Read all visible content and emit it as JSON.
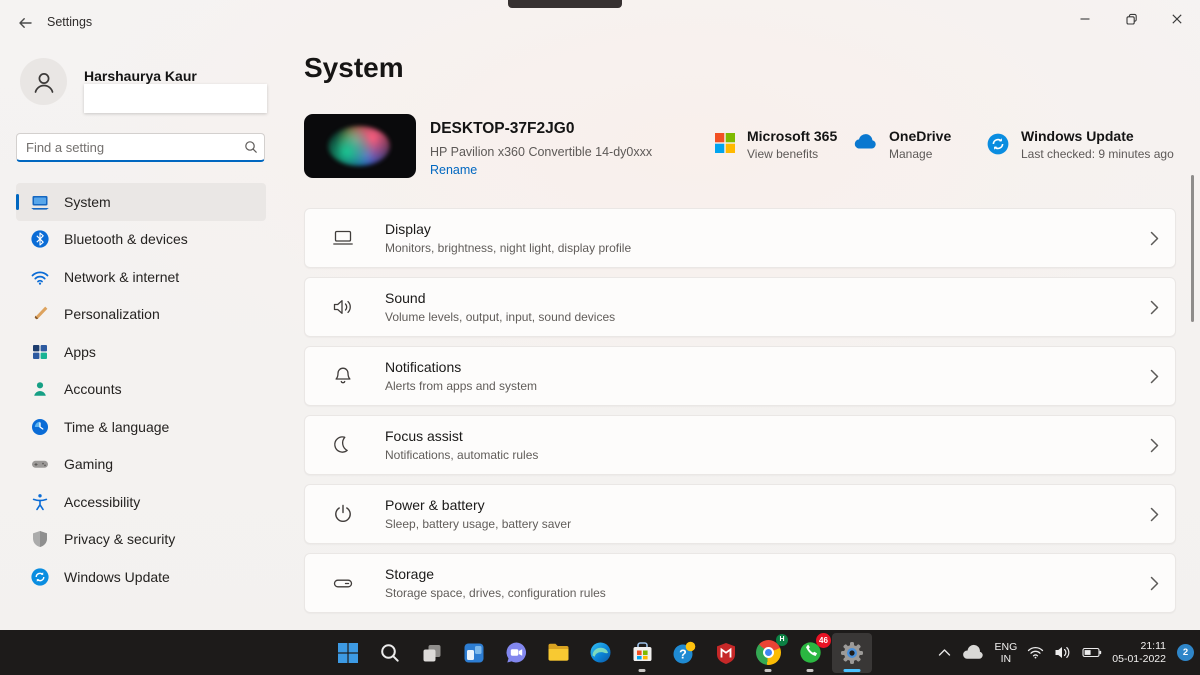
{
  "window": {
    "title": "Settings"
  },
  "sidebar": {
    "user": {
      "name": "Harshaurya Kaur"
    },
    "search": {
      "placeholder": "Find a setting"
    },
    "items": [
      {
        "label": "System",
        "active": true
      },
      {
        "label": "Bluetooth & devices"
      },
      {
        "label": "Network & internet"
      },
      {
        "label": "Personalization"
      },
      {
        "label": "Apps"
      },
      {
        "label": "Accounts"
      },
      {
        "label": "Time & language"
      },
      {
        "label": "Gaming"
      },
      {
        "label": "Accessibility"
      },
      {
        "label": "Privacy & security"
      },
      {
        "label": "Windows Update"
      }
    ]
  },
  "main": {
    "page_title": "System",
    "device": {
      "name": "DESKTOP-37F2JG0",
      "model": "HP Pavilion x360 Convertible 14-dy0xxx",
      "rename_label": "Rename"
    },
    "quick_info": [
      {
        "title": "Microsoft 365",
        "subtitle": "View benefits"
      },
      {
        "title": "OneDrive",
        "subtitle": "Manage"
      },
      {
        "title": "Windows Update",
        "subtitle": "Last checked: 9 minutes ago"
      }
    ],
    "cards": [
      {
        "title": "Display",
        "subtitle": "Monitors, brightness, night light, display profile"
      },
      {
        "title": "Sound",
        "subtitle": "Volume levels, output, input, sound devices"
      },
      {
        "title": "Notifications",
        "subtitle": "Alerts from apps and system"
      },
      {
        "title": "Focus assist",
        "subtitle": "Notifications, automatic rules"
      },
      {
        "title": "Power & battery",
        "subtitle": "Sleep, battery usage, battery saver"
      },
      {
        "title": "Storage",
        "subtitle": "Storage space, drives, configuration rules"
      }
    ]
  },
  "taskbar": {
    "apps": [
      {
        "name": "start"
      },
      {
        "name": "search"
      },
      {
        "name": "task-view"
      },
      {
        "name": "widgets"
      },
      {
        "name": "chat"
      },
      {
        "name": "file-explorer"
      },
      {
        "name": "edge"
      },
      {
        "name": "microsoft-store"
      },
      {
        "name": "help"
      },
      {
        "name": "mcafee"
      },
      {
        "name": "chrome",
        "badge": "H"
      },
      {
        "name": "whatsapp",
        "badge": "46"
      },
      {
        "name": "settings",
        "active": true
      }
    ],
    "tray": {
      "language_line1": "ENG",
      "language_line2": "IN",
      "time": "21:11",
      "date": "05-01-2022",
      "notification_count": "2"
    }
  },
  "colors": {
    "accent": "#0067c0",
    "taskbar_bg": "#1d1b1a",
    "badge_blue": "#2f86c9",
    "badge_red": "#e81224"
  }
}
